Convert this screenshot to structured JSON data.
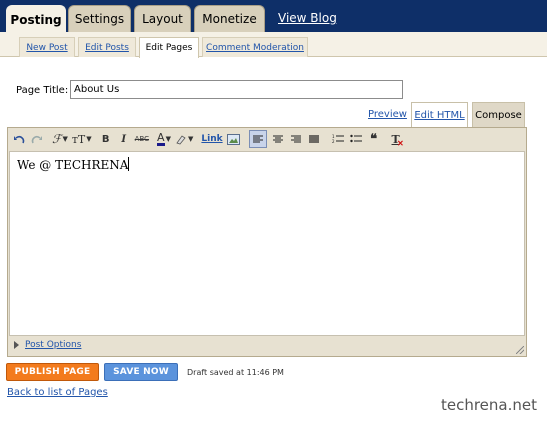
{
  "main_tabs": [
    "Posting",
    "Settings",
    "Layout",
    "Monetize"
  ],
  "view_blog": "View Blog",
  "sub_tabs": [
    "New Post",
    "Edit Posts",
    "Edit Pages",
    "Comment Moderation"
  ],
  "form": {
    "page_title_label": "Page Title:",
    "page_title_value": "About Us"
  },
  "mode_tabs": {
    "preview": "Preview",
    "edit_html": "Edit HTML",
    "compose": "Compose"
  },
  "toolbar": {
    "link_label": "Link",
    "icons": [
      "undo-icon",
      "redo-icon",
      "font-family-icon",
      "font-size-icon",
      "bold-icon",
      "italic-icon",
      "strikethrough-icon",
      "text-color-icon",
      "highlight-icon",
      "link-icon",
      "image-icon",
      "align-left-icon",
      "align-center-icon",
      "align-right-icon",
      "justify-icon",
      "numbered-list-icon",
      "bullet-list-icon",
      "blockquote-icon",
      "remove-formatting-icon"
    ]
  },
  "editor": {
    "content": "We @ TECHRENA"
  },
  "post_options": "Post Options",
  "buttons": {
    "publish": "PUBLISH PAGE",
    "save": "SAVE NOW"
  },
  "draft_status": "Draft saved at 11:46 PM",
  "back_link": "Back to list of Pages",
  "watermark": "techrena.net"
}
